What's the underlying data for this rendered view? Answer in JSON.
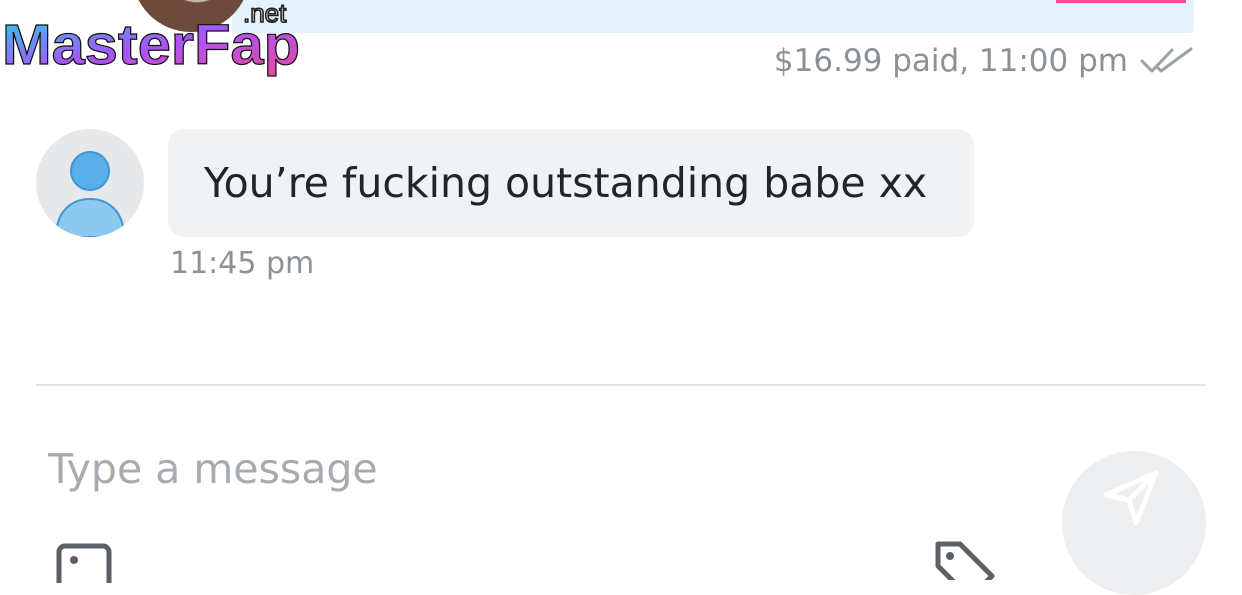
{
  "watermark": {
    "brand": "MasterFap",
    "tld": ".net"
  },
  "sent_message": {
    "meta": "$16.99 paid, 11:00 pm",
    "status_icon": "double-check-icon"
  },
  "received_message": {
    "text": "You’re fucking outstanding babe xx",
    "time": "11:45 pm",
    "avatar_icon": "user-icon"
  },
  "composer": {
    "placeholder": "Type a message",
    "send_icon": "send-icon",
    "media_icon": "image-icon",
    "price_icon": "tag-icon"
  },
  "colors": {
    "sent_bubble": "#e3f2fc",
    "received_bubble": "#f0f2f4",
    "meta_text": "#8c9196",
    "avatar_blue": "#5aaee9",
    "accent_pink": "#ff4f9a"
  }
}
